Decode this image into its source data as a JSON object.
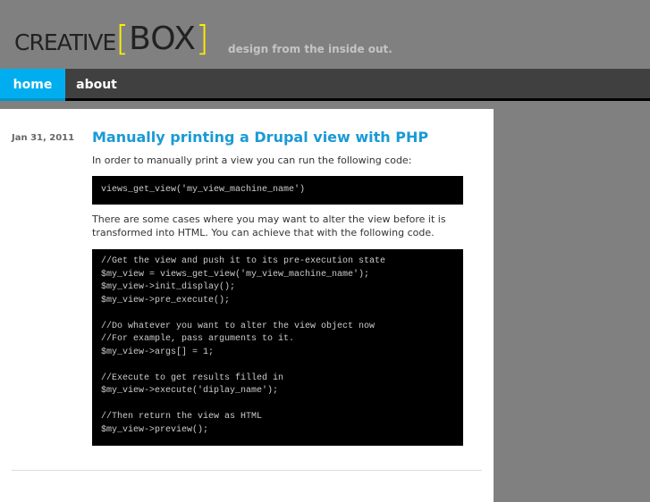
{
  "header": {
    "logo_text": "CREATIVE",
    "logo_bracket_left": "[",
    "logo_box": "BOX",
    "logo_bracket_right": "]",
    "slogan": "design from the inside out."
  },
  "nav": [
    {
      "label": "home",
      "active": true
    },
    {
      "label": "about",
      "active": false
    }
  ],
  "post": {
    "date": "Jan 31, 2011",
    "title": "Manually printing a Drupal view with PHP",
    "intro": "In order to manually print a view you can run the following code:",
    "code1": "views_get_view('my_view_machine_name')",
    "para2": "There are some cases where you may want to alter the view before it is transformed into HTML. You can achieve that with the following code.",
    "code2": "//Get the view and push it to its pre-execution state\n$my_view = views_get_view('my_view_machine_name');\n$my_view->init_display();\n$my_view->pre_execute();\n\n//Do whatever you want to alter the view object now\n//For example, pass arguments to it.\n$my_view->args[] = 1;\n\n//Execute to get results filled in\n$my_view->execute('diplay_name');\n\n//Then return the view as HTML\n$my_view->preview();"
  },
  "colors": {
    "accent": "#00aeef",
    "nav_bg": "#404040",
    "header_bg": "#808080",
    "logo_bracket": "#ffee00"
  }
}
